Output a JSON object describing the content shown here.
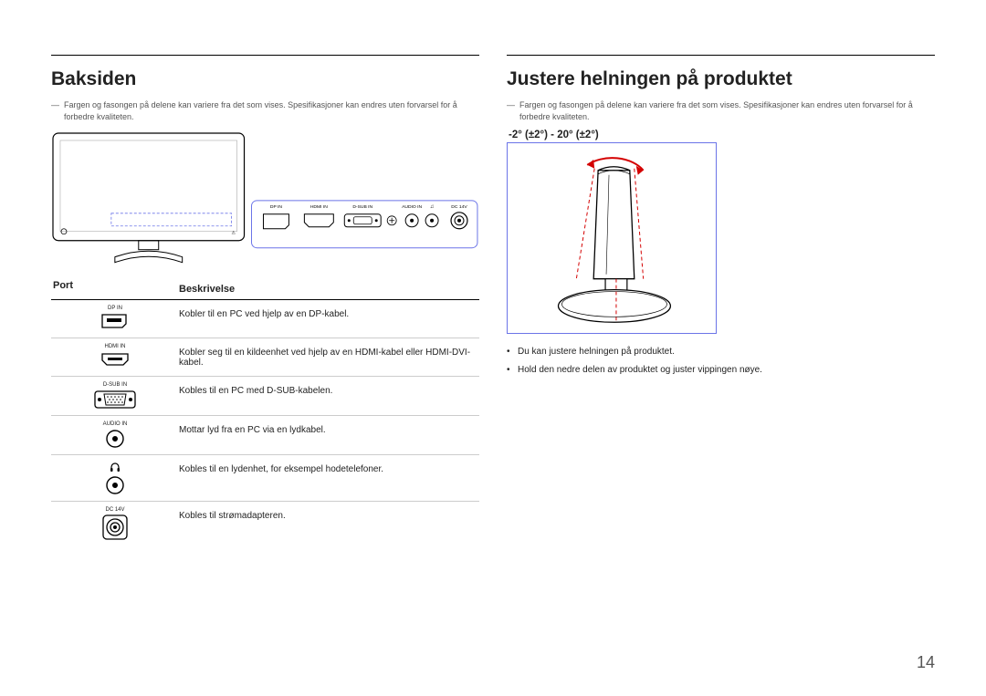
{
  "page_number": "14",
  "left": {
    "title": "Baksiden",
    "disclaimer": "Fargen og fasongen på delene kan variere fra det som vises. Spesifikasjoner kan endres uten forvarsel for å forbedre kvaliteten.",
    "table_head_port": "Port",
    "table_head_desc": "Beskrivelse",
    "panel_labels": {
      "dp": "DP IN",
      "hdmi": "HDMI IN",
      "dsub": "D-SUB IN",
      "audio": "AUDIO IN",
      "hp": "",
      "dc": "DC 14V"
    },
    "rows": [
      {
        "label": "DP IN",
        "desc": "Kobler til en PC ved hjelp av en DP-kabel."
      },
      {
        "label": "HDMI IN",
        "desc": "Kobler seg til en kildeenhet ved hjelp av en HDMI-kabel eller HDMI-DVI-kabel."
      },
      {
        "label": "D-SUB IN",
        "desc": "Kobles til en PC med D-SUB-kabelen."
      },
      {
        "label": "AUDIO IN",
        "desc": "Mottar lyd fra en PC via en lydkabel."
      },
      {
        "label": "",
        "desc": "Kobles til en lydenhet, for eksempel hodetelefoner."
      },
      {
        "label": "DC 14V",
        "desc": "Kobles til strømadapteren."
      }
    ]
  },
  "right": {
    "title": "Justere helningen på produktet",
    "disclaimer": "Fargen og fasongen på delene kan variere fra det som vises. Spesifikasjoner kan endres uten forvarsel for å forbedre kvaliteten.",
    "tilt_range": "-2° (±2°) - 20° (±2°)",
    "notes": [
      "Du kan justere helningen på produktet.",
      "Hold den nedre delen av produktet og juster vippingen nøye."
    ]
  }
}
